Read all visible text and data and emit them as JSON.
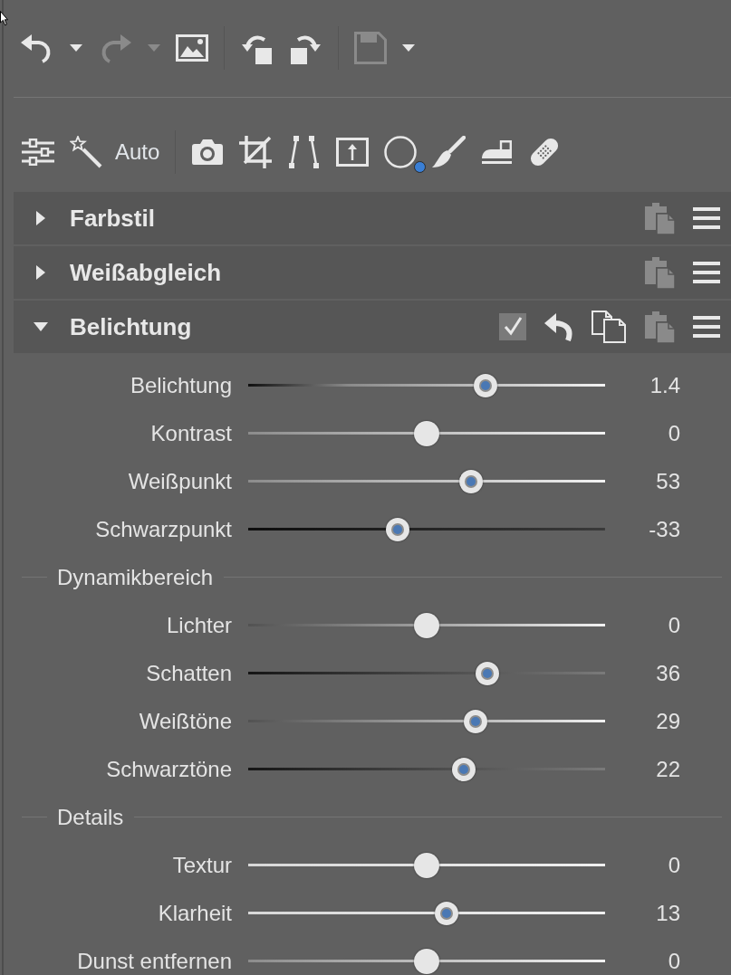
{
  "toolbars": [
    {
      "groups": [
        {
          "items": [
            {
              "kind": "undo",
              "disabled": false
            },
            {
              "kind": "caret",
              "disabled": false
            },
            {
              "kind": "redo",
              "disabled": true
            },
            {
              "kind": "caret",
              "disabled": true
            },
            {
              "kind": "image",
              "disabled": false
            }
          ]
        },
        {
          "items": [
            {
              "kind": "rotate-left",
              "disabled": false
            },
            {
              "kind": "rotate-right",
              "disabled": false
            }
          ]
        },
        {
          "items": [
            {
              "kind": "save",
              "disabled": true
            },
            {
              "kind": "caret",
              "disabled": false
            }
          ]
        }
      ]
    },
    {
      "groups": [
        {
          "items": [
            {
              "kind": "sliders"
            },
            {
              "kind": "auto",
              "label": "Auto"
            }
          ]
        },
        {
          "items": [
            {
              "kind": "camera"
            },
            {
              "kind": "crop"
            },
            {
              "kind": "slanted-lines"
            },
            {
              "kind": "box-arrow"
            },
            {
              "kind": "circle"
            },
            {
              "kind": "brush"
            },
            {
              "kind": "iron"
            },
            {
              "kind": "bandage"
            }
          ]
        }
      ]
    }
  ],
  "sections": [
    {
      "title": "Farbstil",
      "expanded": false,
      "actions": [
        {
          "kind": "paste",
          "disabled": true
        },
        {
          "kind": "menu",
          "disabled": false
        }
      ]
    },
    {
      "title": "Weißabgleich",
      "expanded": false,
      "actions": [
        {
          "kind": "paste",
          "disabled": true
        },
        {
          "kind": "menu",
          "disabled": false
        }
      ]
    },
    {
      "title": "Belichtung",
      "expanded": true,
      "actions": [
        {
          "kind": "checkbox",
          "checked": true,
          "disabled": false
        },
        {
          "kind": "reset",
          "disabled": false
        },
        {
          "kind": "copy",
          "disabled": false
        },
        {
          "kind": "paste",
          "disabled": true
        },
        {
          "kind": "menu",
          "disabled": false
        }
      ],
      "content": [
        {
          "kind": "ramp",
          "label": "Belichtung",
          "level": 0.665,
          "modified": true,
          "reading": "1.4"
        },
        {
          "kind": "soft",
          "label": "Kontrast",
          "level": 0.5,
          "modified": false,
          "reading": "0"
        },
        {
          "kind": "soft",
          "label": "Weißpunkt",
          "level": 0.624,
          "modified": true,
          "reading": "53"
        },
        {
          "kind": "dark",
          "label": "Schwarzpunkt",
          "level": 0.419,
          "modified": true,
          "reading": "-33"
        },
        {
          "kind": "group",
          "label": "Dynamikbereich"
        },
        {
          "kind": "fade",
          "label": "Lichter",
          "level": 0.5,
          "modified": false,
          "reading": "0"
        },
        {
          "kind": "shade",
          "label": "Schatten",
          "level": 0.67,
          "modified": true,
          "reading": "36"
        },
        {
          "kind": "fade",
          "label": "Weißtöne",
          "level": 0.637,
          "modified": true,
          "reading": "29"
        },
        {
          "kind": "shade",
          "label": "Schwarztöne",
          "level": 0.604,
          "modified": true,
          "reading": "22"
        },
        {
          "kind": "group",
          "label": "Details"
        },
        {
          "kind": "flat",
          "label": "Textur",
          "level": 0.5,
          "modified": false,
          "reading": "0"
        },
        {
          "kind": "flat",
          "label": "Klarheit",
          "level": 0.556,
          "modified": true,
          "reading": "13"
        },
        {
          "kind": "soft",
          "label": "Dunst entfernen",
          "level": 0.5,
          "modified": false,
          "reading": "0"
        }
      ]
    }
  ]
}
